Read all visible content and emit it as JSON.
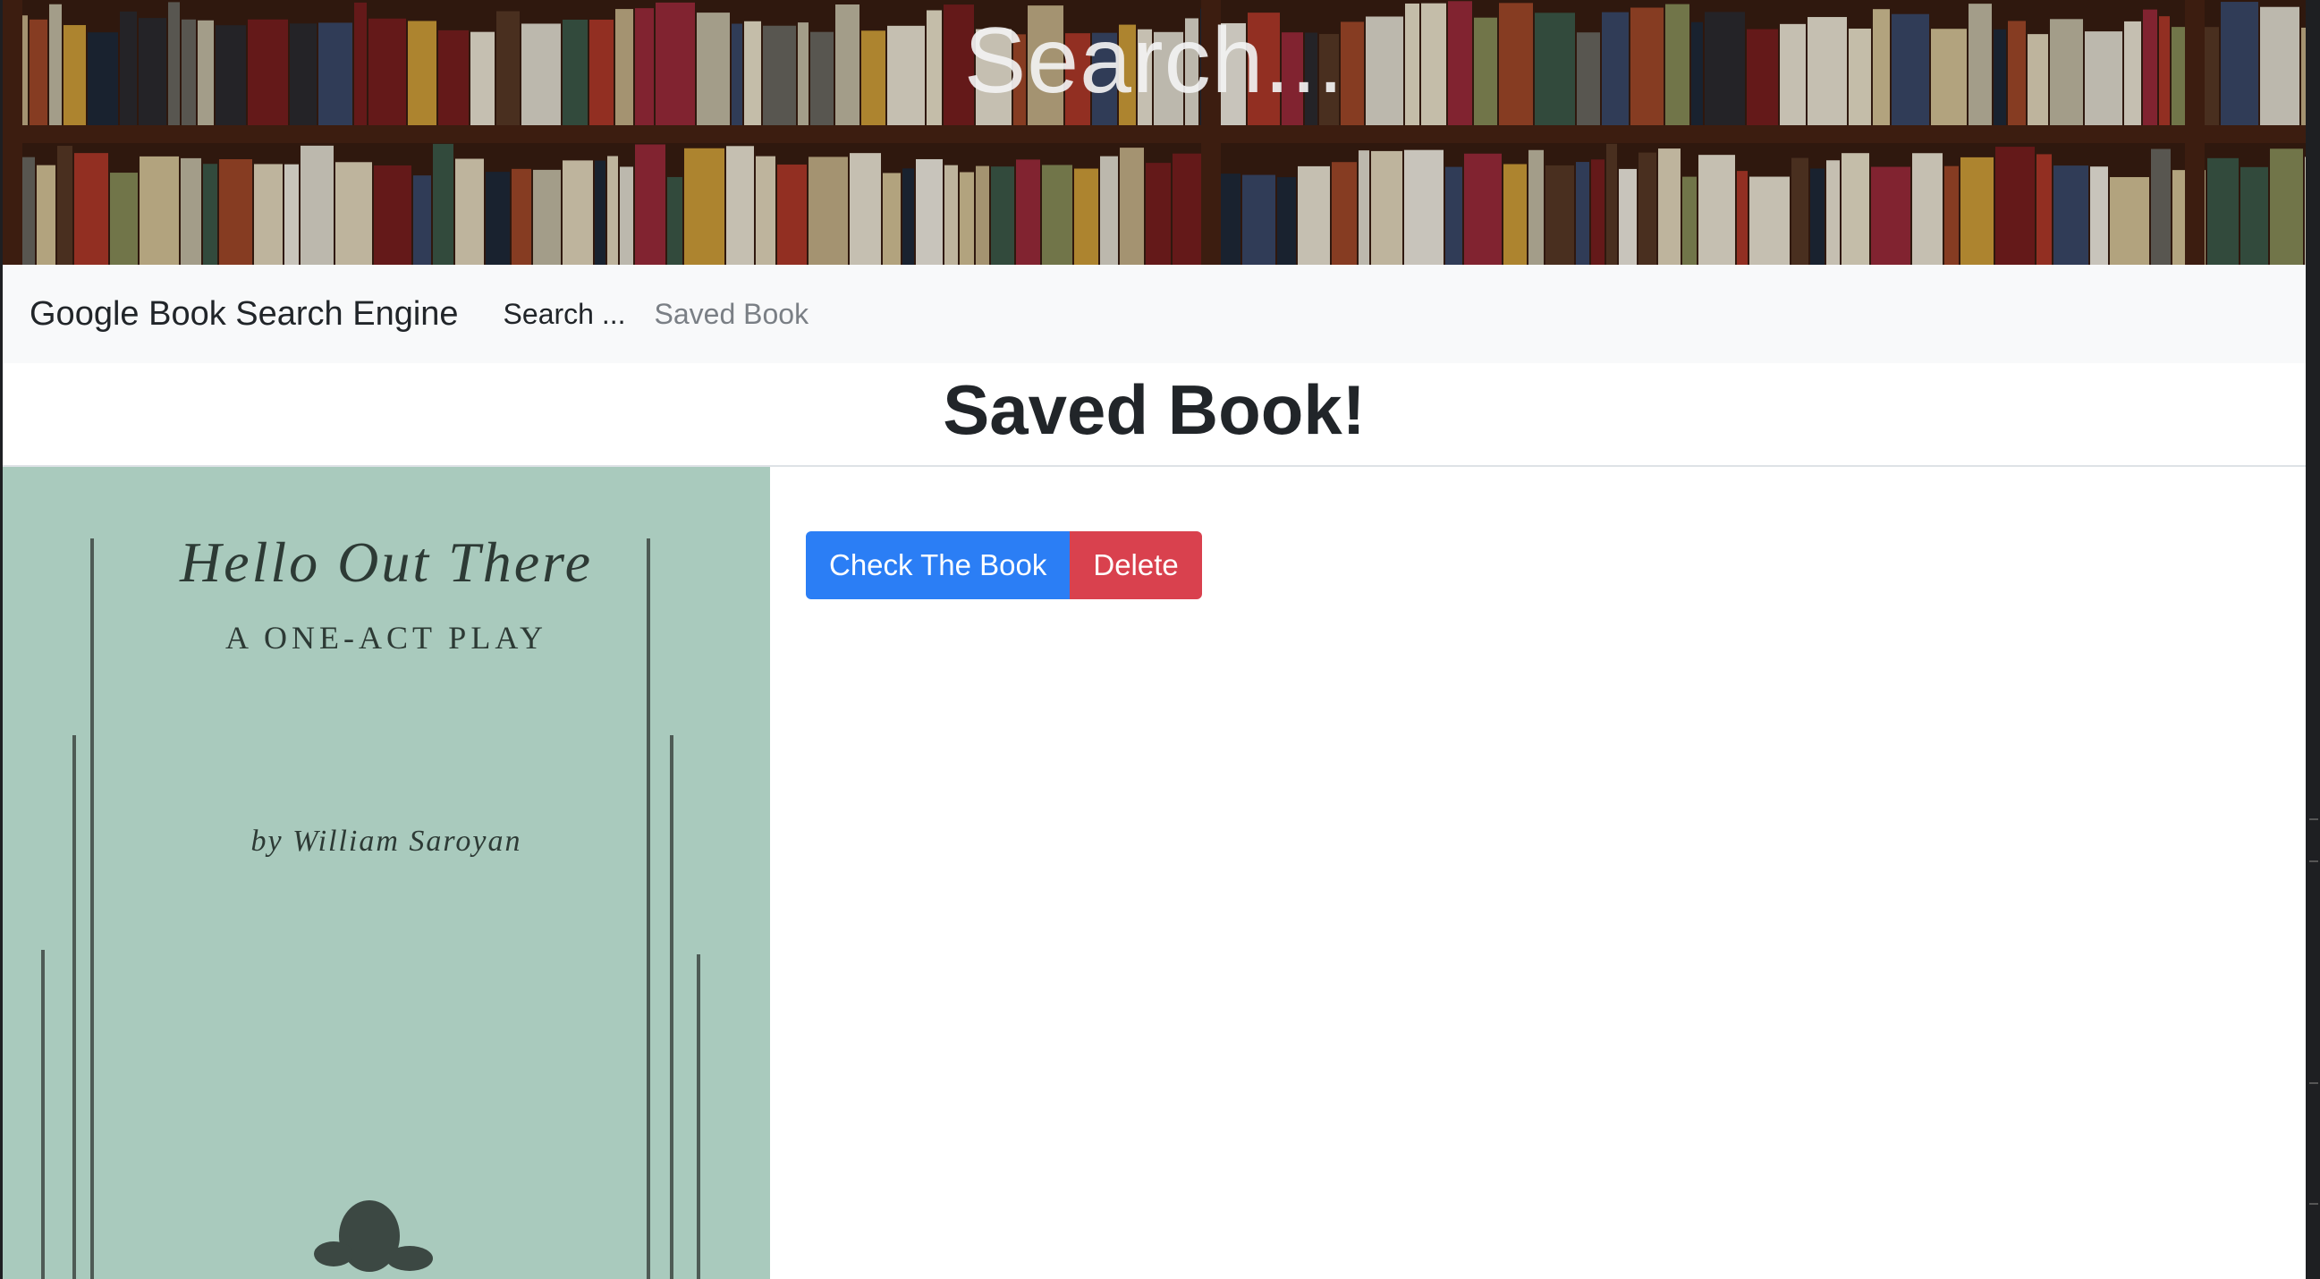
{
  "hero": {
    "title": "Search...",
    "background": "bookshelf-photo"
  },
  "navbar": {
    "brand": "Google Book Search Engine",
    "links": [
      {
        "label": "Search ...",
        "active": true
      },
      {
        "label": "Saved Book",
        "active": false
      }
    ]
  },
  "page": {
    "title": "Saved Book!"
  },
  "book": {
    "cover": {
      "title": "Hello Out There",
      "subtitle": "A ONE-ACT PLAY",
      "author": "by William Saroyan"
    },
    "actions": {
      "check_label": "Check The Book",
      "delete_label": "Delete"
    }
  },
  "colors": {
    "primary": "#2b7ef5",
    "danger": "#d9414e",
    "navbar_bg": "#f8f9fa",
    "cover_bg": "#a9cabd"
  }
}
